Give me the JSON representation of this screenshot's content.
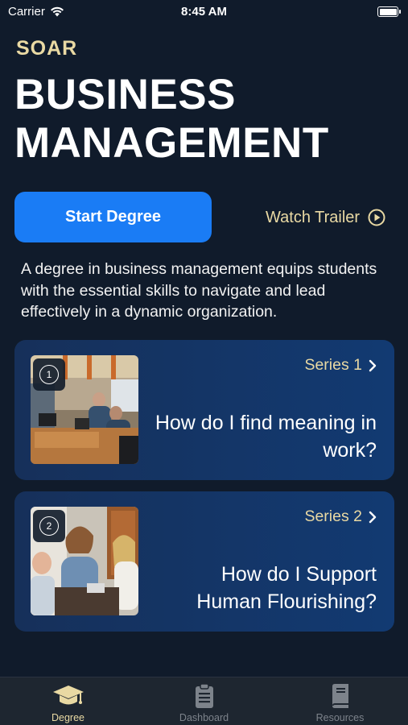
{
  "status_bar": {
    "carrier": "Carrier",
    "time": "8:45 AM"
  },
  "brand": "SOAR",
  "title": "BUSINESS MANAGEMENT",
  "start_button": "Start Degree",
  "trailer_link": "Watch Trailer",
  "description": "A degree in business management equips students with the essential skills to navigate and lead effectively in a dynamic organization.",
  "cards": [
    {
      "number": "1",
      "series_label": "Series 1",
      "title": "How do I find meaning in work?",
      "image": "office-team-photo"
    },
    {
      "number": "2",
      "series_label": "Series 2",
      "title": "How do I Support Human Flourishing?",
      "image": "colleagues-laughing-photo"
    }
  ],
  "tabs": [
    {
      "label": "Degree",
      "icon": "graduation-cap-icon",
      "active": true
    },
    {
      "label": "Dashboard",
      "icon": "clipboard-icon",
      "active": false
    },
    {
      "label": "Resources",
      "icon": "book-icon",
      "active": false
    }
  ],
  "colors": {
    "background": "#101b2b",
    "accent_gold": "#e9d9a3",
    "primary_blue": "#1a7cf5",
    "card_gradient_start": "#16305a",
    "card_gradient_end": "#123a72",
    "tab_inactive": "#7d838b"
  }
}
